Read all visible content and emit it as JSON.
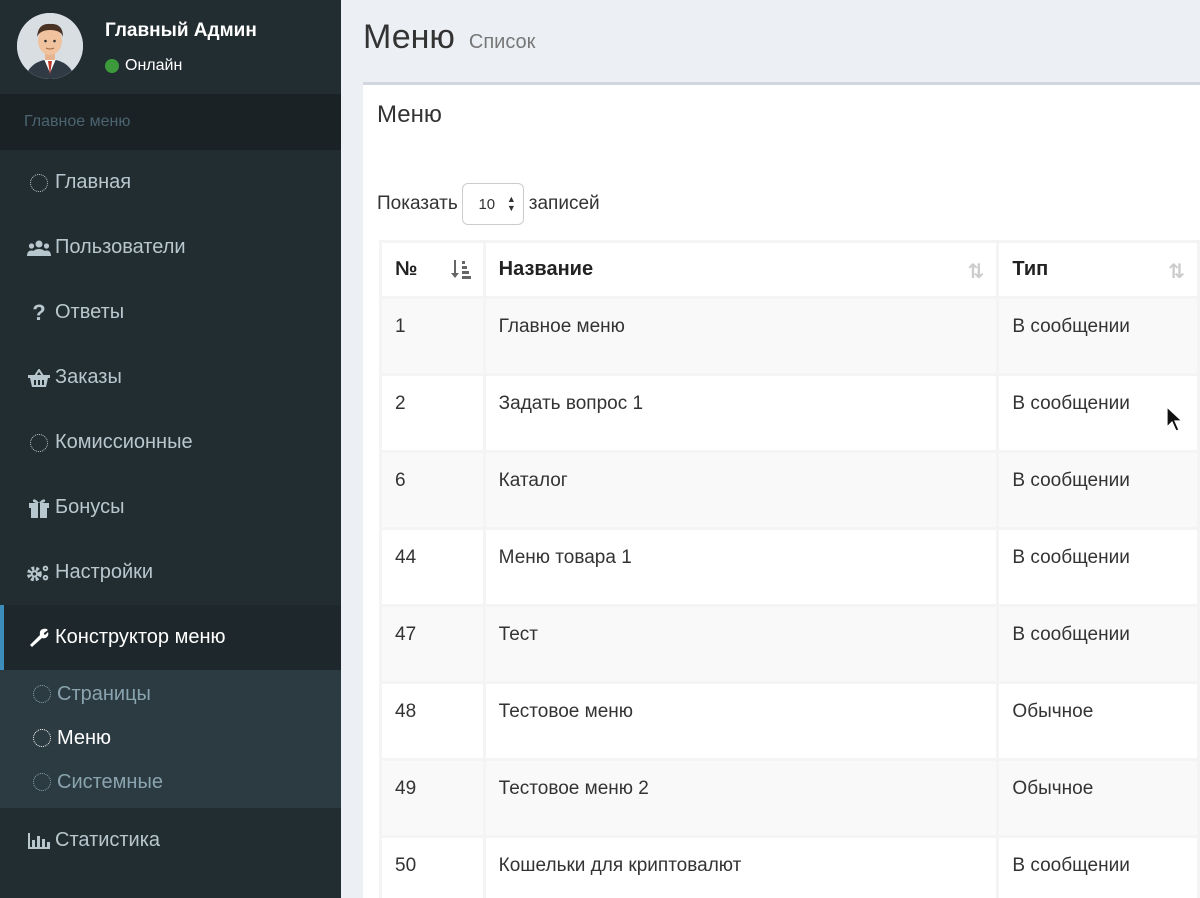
{
  "user": {
    "name": "Главный Админ",
    "status": "Онлайн"
  },
  "sidebar": {
    "header": "Главное меню",
    "items": [
      {
        "label": "Главная",
        "icon": "circle-icon"
      },
      {
        "label": "Пользователи",
        "icon": "users-icon"
      },
      {
        "label": "Ответы",
        "icon": "question-icon"
      },
      {
        "label": "Заказы",
        "icon": "basket-icon"
      },
      {
        "label": "Комиссионные",
        "icon": "circle-icon"
      },
      {
        "label": "Бонусы",
        "icon": "gift-icon"
      },
      {
        "label": "Настройки",
        "icon": "gears-icon"
      },
      {
        "label": "Конструктор меню",
        "icon": "wrench-icon",
        "active": true
      },
      {
        "label": "Статистика",
        "icon": "bar-chart-icon"
      }
    ],
    "submenu": [
      {
        "label": "Страницы"
      },
      {
        "label": "Меню",
        "current": true
      },
      {
        "label": "Системные"
      }
    ]
  },
  "header": {
    "title": "Меню",
    "subtitle": "Список"
  },
  "box": {
    "title": "Меню",
    "length": {
      "prefix": "Показать",
      "value": "10",
      "suffix": "записей"
    }
  },
  "table": {
    "columns": [
      "№",
      "Название",
      "Тип"
    ],
    "rows": [
      {
        "id": "1",
        "name": "Главное меню",
        "type": "В сообщении"
      },
      {
        "id": "2",
        "name": "Задать вопрос 1",
        "type": "В сообщении"
      },
      {
        "id": "6",
        "name": "Каталог",
        "type": "В сообщении"
      },
      {
        "id": "44",
        "name": "Меню товара 1",
        "type": "В сообщении"
      },
      {
        "id": "47",
        "name": "Тест",
        "type": "В сообщении"
      },
      {
        "id": "48",
        "name": "Тестовое меню",
        "type": "Обычное"
      },
      {
        "id": "49",
        "name": "Тестовое меню 2",
        "type": "Обычное"
      },
      {
        "id": "50",
        "name": "Кошельки для криптовалют",
        "type": "В сообщении"
      }
    ]
  },
  "colors": {
    "sidebar_bg": "#222d32",
    "accent": "#3c8dbc",
    "status_online": "#3c9a3c"
  }
}
